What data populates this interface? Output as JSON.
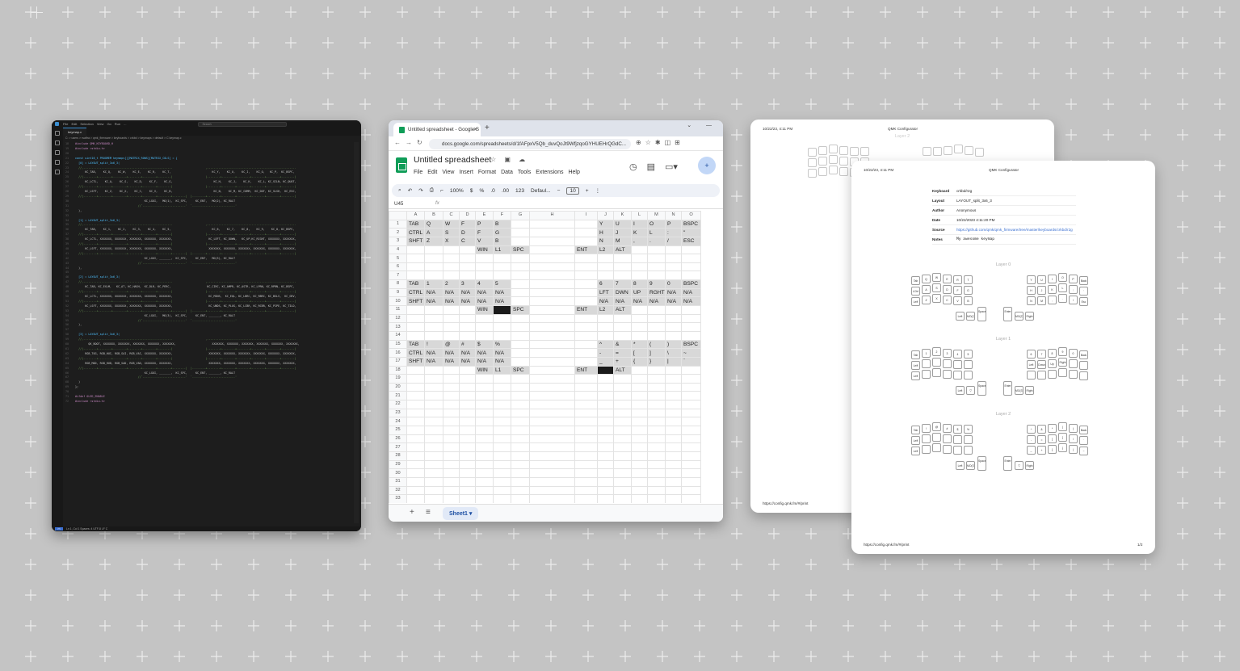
{
  "vscode": {
    "menu": [
      "File",
      "Edit",
      "Selection",
      "View",
      "Go",
      "Run",
      "..."
    ],
    "search": "Search",
    "tab": "keymap.c",
    "breadcrumb": "C: > users > rsaftra > qmk_firmware > keyboards > crkbd > keymaps > default > C keymap.c",
    "status": "Ln 1, Col 1   Spaces: 4   UTF-8   LF   C",
    "code_lines": [
      "#include QMK_KEYBOARD_H",
      "#include <stdio.h>",
      "",
      "const uint16_t PROGMEM keymaps[][MATRIX_ROWS][MATRIX_COLS] = {",
      "  [0] = LAYOUT_split_3x6_3(",
      "  //,-----------------------------------------------------.                    ,-----------------------------------------------------.",
      "      KC_TAB,    KC_Q,    KC_W,    KC_E,    KC_R,    KC_T,                         KC_Y,    KC_U,    KC_I,    KC_O,   KC_P,  KC_BSPC,",
      "  //|--------+--------+--------+--------+--------+--------|                    |--------+--------+--------+--------+--------+--------|",
      "      KC_LCTL,    KC_A,    KC_S,    KC_D,    KC_F,    KC_G,                         KC_H,    KC_J,    KC_K,    KC_L, KC_SCLN, KC_QUOT,",
      "  //|--------+--------+--------+--------+--------+--------|                    |--------+--------+--------+--------+--------+--------|",
      "      KC_LSFT,    KC_Z,    KC_X,    KC_C,    KC_V,    KC_B,                         KC_N,    KC_M, KC_COMM,  KC_DOT, KC_SLSH,  KC_ESC,",
      "  //|--------+--------+--------+--------+--------+--------+--------|  |--------+--------+--------+--------+--------+--------+--------|",
      "                                          KC_LGUI,   MO(1),  KC_SPC,     KC_ENT,   MO(2), KC_RALT",
      "                                      //`--------------------------'  `--------------------------'",
      "  ),",
      "",
      "  [1] = LAYOUT_split_3x6_3(",
      "  //,-----------------------------------------------------.                    ,-----------------------------------------------------.",
      "      KC_TAB,    KC_1,    KC_2,    KC_3,    KC_4,    KC_5,                         KC_6,    KC_7,    KC_8,    KC_9,    KC_0, KC_BSPC,",
      "  //|--------+--------+--------+--------+--------+--------|                    |--------+--------+--------+--------+--------+--------|",
      "      KC_LCTL, XXXXXXX, XXXXXXX, XXXXXXX, XXXXXXX, XXXXXXX,                      KC_LEFT, KC_DOWN,   KC_UP,KC_RIGHT, XXXXXXX, XXXXXXX,",
      "  //|--------+--------+--------+--------+--------+--------|                    |--------+--------+--------+--------+--------+--------|",
      "      KC_LSFT, XXXXXXX, XXXXXXX, XXXXXXX, XXXXXXX, XXXXXXX,                      XXXXXXX, XXXXXXX, XXXXXXX, XXXXXXX, XXXXXXX, XXXXXXX,",
      "  //|--------+--------+--------+--------+--------+--------+--------|  |--------+--------+--------+--------+--------+--------+--------|",
      "                                          KC_LGUI, _______,  KC_SPC,     KC_ENT,   MO(3), KC_RALT",
      "                                      //`--------------------------'  `--------------------------'",
      "  ),",
      "",
      "  [2] = LAYOUT_split_3x6_3(",
      "  //,-----------------------------------------------------.                    ,-----------------------------------------------------.",
      "      KC_TAB, KC_EXLM,   KC_AT, KC_HASH,  KC_DLR, KC_PERC,                      KC_CIRC, KC_AMPR, KC_ASTR, KC_LPRN, KC_RPRN, KC_BSPC,",
      "  //|--------+--------+--------+--------+--------+--------|                    |--------+--------+--------+--------+--------+--------|",
      "      KC_LCTL, XXXXXXX, XXXXXXX, XXXXXXX, XXXXXXX, XXXXXXX,                      KC_MINS,  KC_EQL, KC_LBRC, KC_RBRC, KC_BSLS,  KC_GRV,",
      "  //|--------+--------+--------+--------+--------+--------|                    |--------+--------+--------+--------+--------+--------|",
      "      KC_LSFT, XXXXXXX, XXXXXXX, XXXXXXX, XXXXXXX, XXXXXXX,                      KC_UNDS, KC_PLUS, KC_LCBR, KC_RCBR, KC_PIPE, KC_TILD,",
      "  //|--------+--------+--------+--------+--------+--------+--------|  |--------+--------+--------+--------+--------+--------+--------|",
      "                                          KC_LGUI,   MO(3),  KC_SPC,     KC_ENT, _______, KC_RALT",
      "                                      //`--------------------------'  `--------------------------'",
      "  ),",
      "",
      "  [3] = LAYOUT_split_3x6_3(",
      "  //,-----------------------------------------------------.                    ,-----------------------------------------------------.",
      "        QK_BOOT, XXXXXXX, XXXXXXX, XXXXXXX, XXXXXXX, XXXXXXX,                      XXXXXXX, XXXXXXX, XXXXXXX, XXXXXXX, XXXXXXX, XXXXXXX,",
      "  //|--------+--------+--------+--------+--------+--------|                    |--------+--------+--------+--------+--------+--------|",
      "      RGB_TOG, RGB_HUI, RGB_SAI, RGB_VAI, XXXXXXX, XXXXXXX,                      XXXXXXX, XXXXXXX, XXXXXXX, XXXXXXX, XXXXXXX, XXXXXXX,",
      "  //|--------+--------+--------+--------+--------+--------|                    |--------+--------+--------+--------+--------+--------|",
      "      RGB_MOD, RGB_HUD, RGB_SAD, RGB_VAD, XXXXXXX, XXXXXXX,                      XXXXXXX, XXXXXXX, XXXXXXX, XXXXXXX, XXXXXXX, XXXXXXX,",
      "  //|--------+--------+--------+--------+--------+--------+--------|  |--------+--------+--------+--------+--------+--------+--------|",
      "                                          KC_LGUI, _______,  KC_SPC,     KC_ENT, _______, KC_RALT",
      "                                      //`--------------------------'  `--------------------------'",
      "  )",
      "};",
      "",
      "#ifdef OLED_ENABLE",
      "#include <stdio.h>"
    ]
  },
  "sheets": {
    "tab_title": "Untitled spreadsheet - Google S",
    "url": "docs.google.com/spreadsheets/d/1fAFpxV5Qb_duvQoJt9WfjzqoGYHUEHrQGdC...",
    "doc_title": "Untitled spreadsheet",
    "menu": [
      "File",
      "Edit",
      "View",
      "Insert",
      "Format",
      "Data",
      "Tools",
      "Extensions",
      "Help"
    ],
    "toolbar": {
      "zoom": "100%",
      "currency": "$",
      "percent": "%",
      "dec_less": ".0",
      "dec_more": ".00",
      "num": "123",
      "font": "Defaul...",
      "minus": "−",
      "size": "10",
      "plus": "+"
    },
    "name_box": "U45",
    "fx": "fx",
    "columns": [
      "A",
      "B",
      "C",
      "D",
      "E",
      "F",
      "G",
      "H",
      "I",
      "J",
      "K",
      "L",
      "M",
      "N",
      "O"
    ],
    "rows": [
      [
        "TAB",
        "Q",
        "W",
        "F",
        "P",
        "B",
        "",
        "",
        "",
        "Y",
        "U",
        "I",
        "O",
        "P",
        "BSPC"
      ],
      [
        "CTRL",
        "A",
        "S",
        "D",
        "F",
        "G",
        "",
        "",
        "",
        "H",
        "J",
        "K",
        "L",
        ":",
        "\""
      ],
      [
        "SHFT",
        "Z",
        "X",
        "C",
        "V",
        "B",
        "",
        "",
        "",
        "N",
        "M",
        ",",
        ".",
        "/",
        "ESC"
      ],
      [
        "",
        "",
        "",
        "",
        "WIN",
        "L1",
        "SPC",
        "",
        "ENT",
        "L2",
        "ALT",
        "",
        "",
        "",
        ""
      ],
      [
        "",
        "",
        "",
        "",
        "",
        "",
        "",
        "",
        "",
        "",
        "",
        "",
        "",
        "",
        ""
      ],
      [
        "",
        "",
        "",
        "",
        "",
        "",
        "",
        "",
        "",
        "",
        "",
        "",
        "",
        "",
        ""
      ],
      [
        "",
        "",
        "",
        "",
        "",
        "",
        "",
        "",
        "",
        "",
        "",
        "",
        "",
        "",
        ""
      ],
      [
        "TAB",
        "1",
        "2",
        "3",
        "4",
        "5",
        "",
        "",
        "",
        "6",
        "7",
        "8",
        "9",
        "0",
        "BSPC"
      ],
      [
        "CTRL",
        "N/A",
        "N/A",
        "N/A",
        "N/A",
        "N/A",
        "",
        "",
        "",
        "LFT",
        "DWN",
        "UP",
        "RGHT",
        "N/A",
        "N/A"
      ],
      [
        "SHFT",
        "N/A",
        "N/A",
        "N/A",
        "N/A",
        "N/A",
        "",
        "",
        "",
        "N/A",
        "N/A",
        "N/A",
        "N/A",
        "N/A",
        "N/A"
      ],
      [
        "",
        "",
        "",
        "",
        "WIN",
        "",
        "SPC",
        "",
        "ENT",
        "L2",
        "ALT",
        "",
        "",
        "",
        ""
      ],
      [
        "",
        "",
        "",
        "",
        "",
        "",
        "",
        "",
        "",
        "",
        "",
        "",
        "",
        "",
        ""
      ],
      [
        "",
        "",
        "",
        "",
        "",
        "",
        "",
        "",
        "",
        "",
        "",
        "",
        "",
        "",
        ""
      ],
      [
        "",
        "",
        "",
        "",
        "",
        "",
        "",
        "",
        "",
        "",
        "",
        "",
        "",
        "",
        ""
      ],
      [
        "TAB",
        "!",
        "@",
        "#",
        "$",
        "%",
        "",
        "",
        "",
        "^",
        "&",
        "*",
        "(",
        ")",
        "BSPC"
      ],
      [
        "CTRL",
        "N/A",
        "N/A",
        "N/A",
        "N/A",
        "N/A",
        "",
        "",
        "",
        "-",
        "=",
        "[",
        "]",
        "\\",
        "~"
      ],
      [
        "SHFT",
        "N/A",
        "N/A",
        "N/A",
        "N/A",
        "N/A",
        "",
        "",
        "",
        "_",
        "+",
        "{",
        "}",
        "|",
        "`"
      ],
      [
        "",
        "",
        "",
        "",
        "WIN",
        "L1",
        "SPC",
        "",
        "ENT",
        "",
        "ALT",
        "",
        "",
        "",
        ""
      ],
      [
        "",
        "",
        "",
        "",
        "",
        "",
        "",
        "",
        "",
        "",
        "",
        "",
        "",
        "",
        ""
      ],
      [
        "",
        "",
        "",
        "",
        "",
        "",
        "",
        "",
        "",
        "",
        "",
        "",
        "",
        "",
        ""
      ],
      [
        "",
        "",
        "",
        "",
        "",
        "",
        "",
        "",
        "",
        "",
        "",
        "",
        "",
        "",
        ""
      ],
      [
        "",
        "",
        "",
        "",
        "",
        "",
        "",
        "",
        "",
        "",
        "",
        "",
        "",
        "",
        ""
      ],
      [
        "",
        "",
        "",
        "",
        "",
        "",
        "",
        "",
        "",
        "",
        "",
        "",
        "",
        "",
        ""
      ],
      [
        "",
        "",
        "",
        "",
        "",
        "",
        "",
        "",
        "",
        "",
        "",
        "",
        "",
        "",
        ""
      ],
      [
        "",
        "",
        "",
        "",
        "",
        "",
        "",
        "",
        "",
        "",
        "",
        "",
        "",
        "",
        ""
      ],
      [
        "",
        "",
        "",
        "",
        "",
        "",
        "",
        "",
        "",
        "",
        "",
        "",
        "",
        "",
        ""
      ],
      [
        "",
        "",
        "",
        "",
        "",
        "",
        "",
        "",
        "",
        "",
        "",
        "",
        "",
        "",
        ""
      ],
      [
        "",
        "",
        "",
        "",
        "",
        "",
        "",
        "",
        "",
        "",
        "",
        "",
        "",
        "",
        ""
      ],
      [
        "",
        "",
        "",
        "",
        "",
        "",
        "",
        "",
        "",
        "",
        "",
        "",
        "",
        "",
        ""
      ],
      [
        "",
        "",
        "",
        "",
        "",
        "",
        "",
        "",
        "",
        "",
        "",
        "",
        "",
        "",
        ""
      ],
      [
        "",
        "",
        "",
        "",
        "",
        "",
        "",
        "",
        "",
        "",
        "",
        "",
        "",
        "",
        ""
      ],
      [
        "",
        "",
        "",
        "",
        "",
        "",
        "",
        "",
        "",
        "",
        "",
        "",
        "",
        "",
        ""
      ],
      [
        "",
        "",
        "",
        "",
        "",
        "",
        "",
        "",
        "",
        "",
        "",
        "",
        "",
        "",
        ""
      ]
    ],
    "sheet_tab": "Sheet1 ▾",
    "add_sheet": "+",
    "all_sheets": "≡"
  },
  "print_back": {
    "date": "10/22/23, 4:11 PM",
    "title": "QMK Configurator",
    "layer_label": "Layer 2",
    "footer_url": "https://config.qmk.fm/#/print"
  },
  "print_front": {
    "date": "10/22/23, 4:11 PM",
    "title": "QMK Configurator",
    "meta": [
      {
        "key": "Keyboard",
        "value": "crkbd/r2g"
      },
      {
        "key": "Layout",
        "value": "LAYOUT_split_3x6_3"
      },
      {
        "key": "Author",
        "value": "Anonymous"
      },
      {
        "key": "Date",
        "value": "10/22/2023 4:11:20 PM"
      },
      {
        "key": "Source",
        "value": "https://github.com/qmk/qmk_firmware/tree/master/keyboards/crkbd/r2g"
      },
      {
        "key": "Notes",
        "value": "My awesome keymap"
      }
    ],
    "layers": [
      {
        "label": "Layer 0",
        "left": [
          [
            "Tab",
            "Q",
            "W",
            "E",
            "R",
            "T"
          ],
          [
            "LCtrl",
            "A",
            "S",
            "D",
            "F",
            "G"
          ],
          [
            "Left Shift",
            "Z",
            "X",
            "C",
            "V",
            "B"
          ]
        ],
        "left_thumbs": [
          "Left GUI",
          "MO(1)",
          "Space"
        ],
        "right": [
          [
            "Y",
            "U",
            "I",
            "O",
            "P",
            "Back Space"
          ],
          [
            "H",
            "J",
            "K",
            "L",
            ";",
            "'"
          ],
          [
            "N",
            "M",
            ",",
            ".",
            "/",
            "Esc"
          ]
        ],
        "right_thumbs": [
          "Enter",
          "MO(2)",
          "Right Alt"
        ]
      },
      {
        "label": "Layer 1",
        "left": [
          [
            "Tab",
            "1",
            "2",
            "3",
            "4",
            "5"
          ],
          [
            "Left Ctrl",
            "",
            "",
            "",
            "",
            ""
          ],
          [
            "Left Shift",
            "",
            "",
            "",
            "",
            ""
          ]
        ],
        "left_thumbs": [
          "Left GUI",
          "▽",
          "Space"
        ],
        "right": [
          [
            "6",
            "7",
            "8",
            "9",
            "0",
            "Back Space"
          ],
          [
            "Left",
            "Down",
            "Up",
            "Right",
            "",
            ""
          ],
          [
            "",
            "",
            "",
            "",
            "",
            ""
          ]
        ],
        "right_thumbs": [
          "Enter",
          "MO(3)",
          "Right Alt"
        ]
      },
      {
        "label": "Layer 2",
        "left": [
          [
            "Tab",
            "!",
            "@",
            "#",
            "$",
            "%"
          ],
          [
            "Left Ctrl",
            "",
            "",
            "",
            "",
            ""
          ],
          [
            "Left Shift",
            "",
            "",
            "",
            "",
            ""
          ]
        ],
        "left_thumbs": [
          "Left GUI",
          "MO(3)",
          "Space"
        ],
        "right": [
          [
            "^",
            "&",
            "*",
            "(",
            ")",
            "Back Space"
          ],
          [
            "-",
            "=",
            "[",
            "]",
            "\\",
            "`"
          ],
          [
            "_",
            "+",
            "{",
            "}",
            "|",
            "~"
          ]
        ],
        "right_thumbs": [
          "Enter",
          "▽",
          "Right Alt"
        ]
      }
    ],
    "footer_url": "https://config.qmk.fm/#/print",
    "page_num": "1/2"
  }
}
